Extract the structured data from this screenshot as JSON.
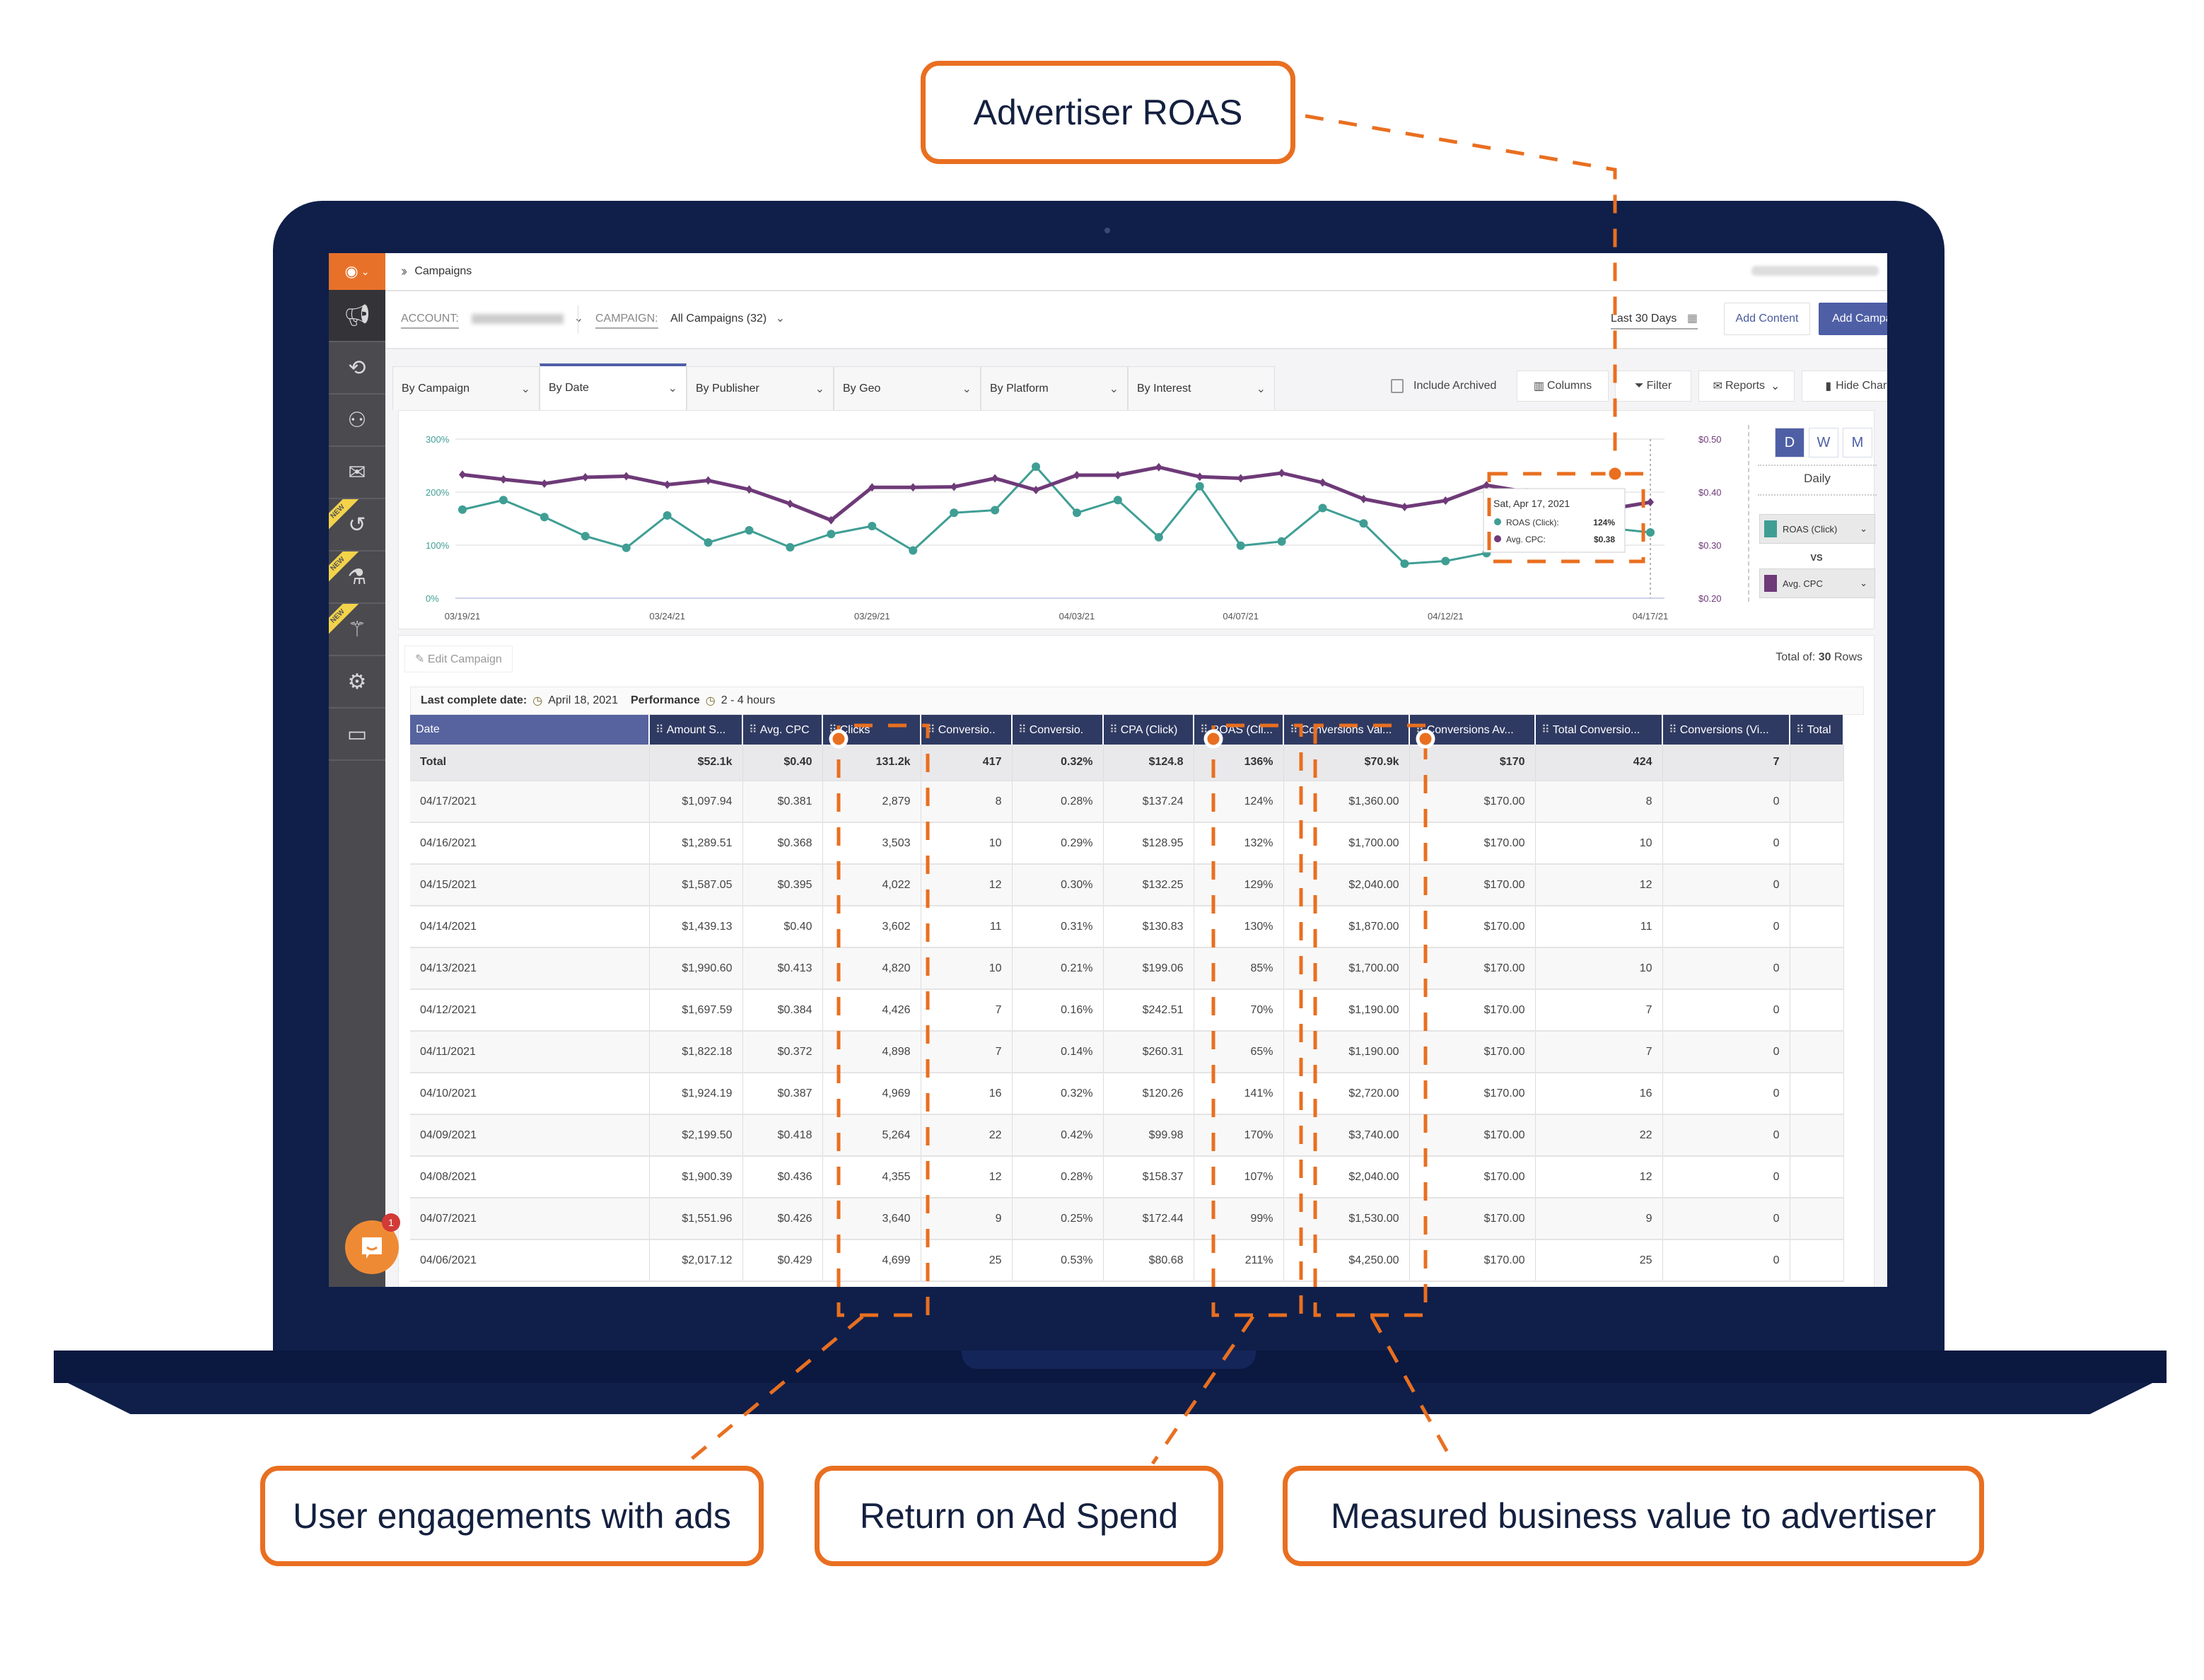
{
  "callouts": {
    "top": "Advertiser ROAS",
    "bottom": [
      "User engagements with ads",
      "Return on Ad Spend",
      "Measured business value to advertiser"
    ]
  },
  "colors": {
    "accent_orange": "#e96f20",
    "primary_blue": "#4f5fa6",
    "header_navy": "#2f3a63",
    "roas_teal": "#3f9e94",
    "cpc_purple": "#6e3a78",
    "laptop_navy": "#0f1f4a"
  },
  "sidebar": {
    "items": [
      {
        "icon": "megaphone-icon",
        "new": false
      },
      {
        "icon": "code-sync-icon",
        "new": false
      },
      {
        "icon": "users-icon",
        "new": false
      },
      {
        "icon": "mail-clock-icon",
        "new": false
      },
      {
        "icon": "history-icon",
        "new": true
      },
      {
        "icon": "flask-icon",
        "new": true
      },
      {
        "icon": "magic-wand-icon",
        "new": true
      },
      {
        "icon": "gear-icon",
        "new": false
      },
      {
        "icon": "billing-icon",
        "new": false
      }
    ],
    "new_label": "NEW"
  },
  "topbar": {
    "breadcrumb": "Campaigns"
  },
  "filters": {
    "account_label": "ACCOUNT:",
    "campaign_label": "CAMPAIGN:",
    "campaign_value": "All Campaigns (32)",
    "date_range": "Last 30 Days",
    "add_content": "Add Content",
    "add_campaign": "Add Campaign"
  },
  "tabs": [
    {
      "label": "By Campaign",
      "active": false
    },
    {
      "label": "By Date",
      "active": true
    },
    {
      "label": "By Publisher",
      "active": false
    },
    {
      "label": "By Geo",
      "active": false
    },
    {
      "label": "By Platform",
      "active": false
    },
    {
      "label": "By Interest",
      "active": false
    }
  ],
  "toolbar": {
    "include_archived": "Include Archived",
    "columns": "Columns",
    "filter": "Filter",
    "reports": "Reports",
    "hide_chart": "Hide Chart"
  },
  "chart_panel": {
    "granularity": [
      "D",
      "W",
      "M"
    ],
    "granularity_active": "D",
    "granularity_label": "Daily",
    "metric1": "ROAS (Click)",
    "vs": "VS",
    "metric2": "Avg. CPC"
  },
  "chart_data": {
    "type": "line",
    "title": "",
    "x": [
      "03/19/21",
      "03/20/21",
      "03/21/21",
      "03/22/21",
      "03/23/21",
      "03/24/21",
      "03/25/21",
      "03/26/21",
      "03/27/21",
      "03/28/21",
      "03/29/21",
      "03/30/21",
      "03/31/21",
      "04/01/21",
      "04/02/21",
      "04/03/21",
      "04/04/21",
      "04/05/21",
      "04/06/21",
      "04/07/21",
      "04/08/21",
      "04/09/21",
      "04/10/21",
      "04/11/21",
      "04/12/21",
      "04/13/21",
      "04/14/21",
      "04/15/21",
      "04/16/21",
      "04/17/21"
    ],
    "x_tick_labels": [
      "03/19/21",
      "03/24/21",
      "03/29/21",
      "04/03/21",
      "04/07/21",
      "04/12/21",
      "04/17/21"
    ],
    "series": [
      {
        "name": "ROAS (Click)",
        "axis": "left",
        "color": "#3f9e94",
        "values": [
          167,
          185,
          153,
          117,
          95,
          156,
          105,
          128,
          96,
          121,
          136,
          90,
          161,
          166,
          248,
          161,
          185,
          115,
          211,
          99,
          107,
          170,
          141,
          65,
          70,
          85,
          130,
          129,
          132,
          124
        ]
      },
      {
        "name": "Avg. CPC",
        "axis": "right",
        "color": "#6e3a78",
        "values": [
          0.433,
          0.424,
          0.416,
          0.428,
          0.43,
          0.414,
          0.422,
          0.405,
          0.378,
          0.347,
          0.409,
          0.409,
          0.41,
          0.426,
          0.404,
          0.432,
          0.432,
          0.447,
          0.429,
          0.426,
          0.436,
          0.418,
          0.387,
          0.372,
          0.384,
          0.413,
          0.4,
          0.395,
          0.368,
          0.381
        ]
      }
    ],
    "y_left": {
      "ticks": [
        "0%",
        "100%",
        "200%",
        "300%"
      ],
      "range": [
        0,
        300
      ]
    },
    "y_right": {
      "ticks": [
        "$0.20",
        "$0.30",
        "$0.40",
        "$0.50"
      ],
      "range": [
        0.2,
        0.5
      ]
    },
    "grid": true,
    "tooltip": {
      "date": "Sat, Apr 17, 2021",
      "rows": [
        {
          "label": "ROAS (Click):",
          "value": "124%"
        },
        {
          "label": "Avg. CPC:",
          "value": "$0.38"
        }
      ]
    }
  },
  "table": {
    "edit_campaign": "Edit Campaign",
    "total_rows_prefix": "Total of:",
    "total_rows_count": "30",
    "total_rows_suffix": "Rows",
    "last_complete_label": "Last complete date:",
    "last_complete_value": "April 18, 2021",
    "performance_label": "Performance",
    "performance_value": "2 - 4 hours",
    "columns": [
      "Date",
      "Amount S...",
      "Avg. CPC",
      "Clicks",
      "Conversio..",
      "Conversio.",
      "CPA (Click)",
      "ROAS (Cli...",
      "Conversions Val...",
      "Conversions Av...",
      "Total Conversio...",
      "Conversions (Vi...",
      "Total"
    ],
    "total_row": [
      "Total",
      "$52.1k",
      "$0.40",
      "131.2k",
      "417",
      "0.32%",
      "$124.8",
      "136%",
      "$70.9k",
      "$170",
      "424",
      "7",
      ""
    ],
    "rows": [
      [
        "04/17/2021",
        "$1,097.94",
        "$0.381",
        "2,879",
        "8",
        "0.28%",
        "$137.24",
        "124%",
        "$1,360.00",
        "$170.00",
        "8",
        "0",
        ""
      ],
      [
        "04/16/2021",
        "$1,289.51",
        "$0.368",
        "3,503",
        "10",
        "0.29%",
        "$128.95",
        "132%",
        "$1,700.00",
        "$170.00",
        "10",
        "0",
        ""
      ],
      [
        "04/15/2021",
        "$1,587.05",
        "$0.395",
        "4,022",
        "12",
        "0.30%",
        "$132.25",
        "129%",
        "$2,040.00",
        "$170.00",
        "12",
        "0",
        ""
      ],
      [
        "04/14/2021",
        "$1,439.13",
        "$0.40",
        "3,602",
        "11",
        "0.31%",
        "$130.83",
        "130%",
        "$1,870.00",
        "$170.00",
        "11",
        "0",
        ""
      ],
      [
        "04/13/2021",
        "$1,990.60",
        "$0.413",
        "4,820",
        "10",
        "0.21%",
        "$199.06",
        "85%",
        "$1,700.00",
        "$170.00",
        "10",
        "0",
        ""
      ],
      [
        "04/12/2021",
        "$1,697.59",
        "$0.384",
        "4,426",
        "7",
        "0.16%",
        "$242.51",
        "70%",
        "$1,190.00",
        "$170.00",
        "7",
        "0",
        ""
      ],
      [
        "04/11/2021",
        "$1,822.18",
        "$0.372",
        "4,898",
        "7",
        "0.14%",
        "$260.31",
        "65%",
        "$1,190.00",
        "$170.00",
        "7",
        "0",
        ""
      ],
      [
        "04/10/2021",
        "$1,924.19",
        "$0.387",
        "4,969",
        "16",
        "0.32%",
        "$120.26",
        "141%",
        "$2,720.00",
        "$170.00",
        "16",
        "0",
        ""
      ],
      [
        "04/09/2021",
        "$2,199.50",
        "$0.418",
        "5,264",
        "22",
        "0.42%",
        "$99.98",
        "170%",
        "$3,740.00",
        "$170.00",
        "22",
        "0",
        ""
      ],
      [
        "04/08/2021",
        "$1,900.39",
        "$0.436",
        "4,355",
        "12",
        "0.28%",
        "$158.37",
        "107%",
        "$2,040.00",
        "$170.00",
        "12",
        "0",
        ""
      ],
      [
        "04/07/2021",
        "$1,551.96",
        "$0.426",
        "3,640",
        "9",
        "0.25%",
        "$172.44",
        "99%",
        "$1,530.00",
        "$170.00",
        "9",
        "0",
        ""
      ],
      [
        "04/06/2021",
        "$2,017.12",
        "$0.429",
        "4,699",
        "25",
        "0.53%",
        "$80.68",
        "211%",
        "$4,250.00",
        "$170.00",
        "25",
        "0",
        ""
      ]
    ]
  },
  "chat": {
    "badge": "1"
  }
}
